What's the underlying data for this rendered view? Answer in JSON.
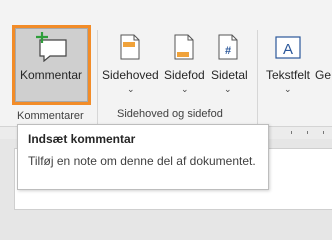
{
  "ribbon": {
    "comment_group": {
      "button_label": "Kommentar",
      "group_label": "Kommentarer",
      "icon": "new-comment-icon"
    },
    "header_footer_group": {
      "group_label": "Sidehoved og sidefod",
      "buttons": [
        {
          "label": "Sidehoved",
          "icon": "header-icon"
        },
        {
          "label": "Sidefod",
          "icon": "footer-icon"
        },
        {
          "label": "Sidetal",
          "icon": "page-number-icon"
        }
      ]
    },
    "text_group": {
      "buttons": [
        {
          "label": "Tekstfelt",
          "icon": "text-box-icon"
        },
        {
          "label": "Ge",
          "icon": "quick-parts-icon"
        }
      ]
    }
  },
  "tooltip": {
    "title": "Indsæt kommentar",
    "description": "Tilføj en note om denne del af dokumentet."
  },
  "colors": {
    "highlight_border": "#f28c28",
    "accent_blue": "#2b579a",
    "plus_green": "#2e9e3a"
  }
}
